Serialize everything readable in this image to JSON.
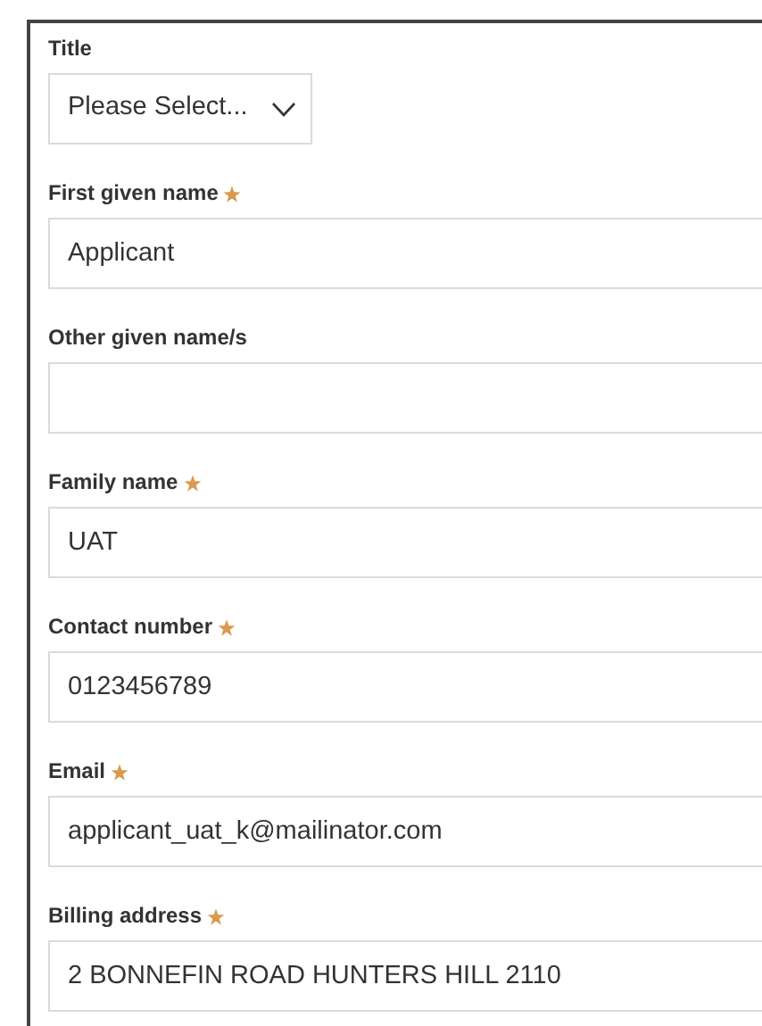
{
  "sections": [
    {
      "fields": [
        {
          "label": "Title",
          "kind": "select",
          "value": "Please Select...",
          "required": false
        },
        {
          "label": "First given name",
          "kind": "text",
          "value": "Applicant",
          "required": true
        },
        {
          "label": "Other given name/s",
          "kind": "text",
          "required": false
        },
        {
          "label": "Family name",
          "kind": "text",
          "value": "UAT",
          "required": true
        },
        {
          "label": "Contact number",
          "kind": "text",
          "value": "0123456789",
          "required": true
        },
        {
          "label": "Email",
          "kind": "text",
          "value": "applicant_uat_k@mailinator.com",
          "required": true
        }
      ]
    },
    {
      "fields": [
        {
          "label": "Billing address",
          "kind": "text",
          "value": "2 BONNEFIN ROAD HUNTERS HILL 2110",
          "required": true
        }
      ]
    }
  ]
}
